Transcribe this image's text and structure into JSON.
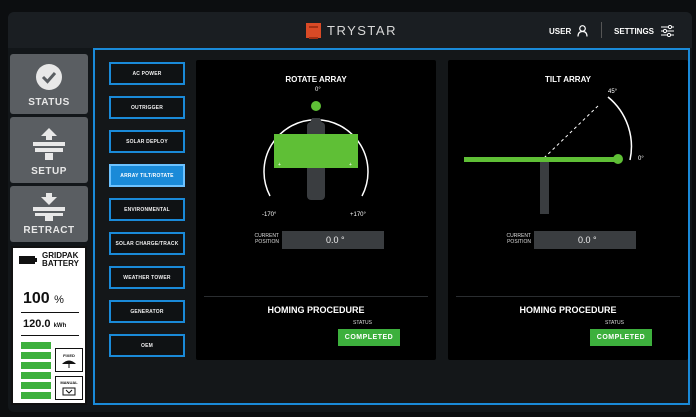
{
  "header": {
    "brand": "TRYSTAR",
    "user_label": "USER",
    "settings_label": "SETTINGS"
  },
  "sidebar": {
    "status_label": "STATUS",
    "setup_label": "SETUP",
    "retract_label": "RETRACT"
  },
  "battery": {
    "title_line1": "GRIDPAK",
    "title_line2": "BATTERY",
    "percent": "100",
    "percent_unit": "%",
    "energy": "120.0",
    "energy_unit": "kWh",
    "fixed_label": "FIXED",
    "manual_label": "MANUAL",
    "level_percent": 100
  },
  "menu": {
    "items": [
      {
        "label": "AC POWER"
      },
      {
        "label": "OUTRIGGER"
      },
      {
        "label": "SOLAR DEPLOY"
      },
      {
        "label": "ARRAY TILT/ROTATE"
      },
      {
        "label": "ENVIRONMENTAL"
      },
      {
        "label": "SOLAR CHARGE/TRACK"
      },
      {
        "label": "WEATHER TOWER"
      },
      {
        "label": "GENERATOR"
      },
      {
        "label": "OEM"
      }
    ],
    "active_index": 3
  },
  "rotate": {
    "title": "ROTATE ARRAY",
    "top_angle": "0°",
    "left_angle": "-170°",
    "right_angle": "+170°",
    "position_label_1": "CURRENT",
    "position_label_2": "POSITION",
    "position_value": "0.0 °",
    "homing_label": "HOMING PROCEDURE",
    "status_label": "STATUS",
    "status_value": "COMPLETED"
  },
  "tilt": {
    "title": "TILT ARRAY",
    "top_angle": "45°",
    "right_angle": "0°",
    "position_label_1": "CURRENT",
    "position_label_2": "POSITION",
    "position_value": "0.0 °",
    "homing_label": "HOMING PROCEDURE",
    "status_label": "STATUS",
    "status_value": "COMPLETED"
  },
  "colors": {
    "accent": "#1a8ad8",
    "success": "#3db03d",
    "brand": "#d94a26"
  },
  "icons": {
    "status": "check-circle-icon",
    "setup": "solar-panel-up-icon",
    "retract": "solar-panel-down-icon",
    "user": "user-icon",
    "settings": "sliders-icon",
    "battery": "battery-icon",
    "fixed": "umbrella-icon",
    "manual": "manual-control-icon"
  }
}
